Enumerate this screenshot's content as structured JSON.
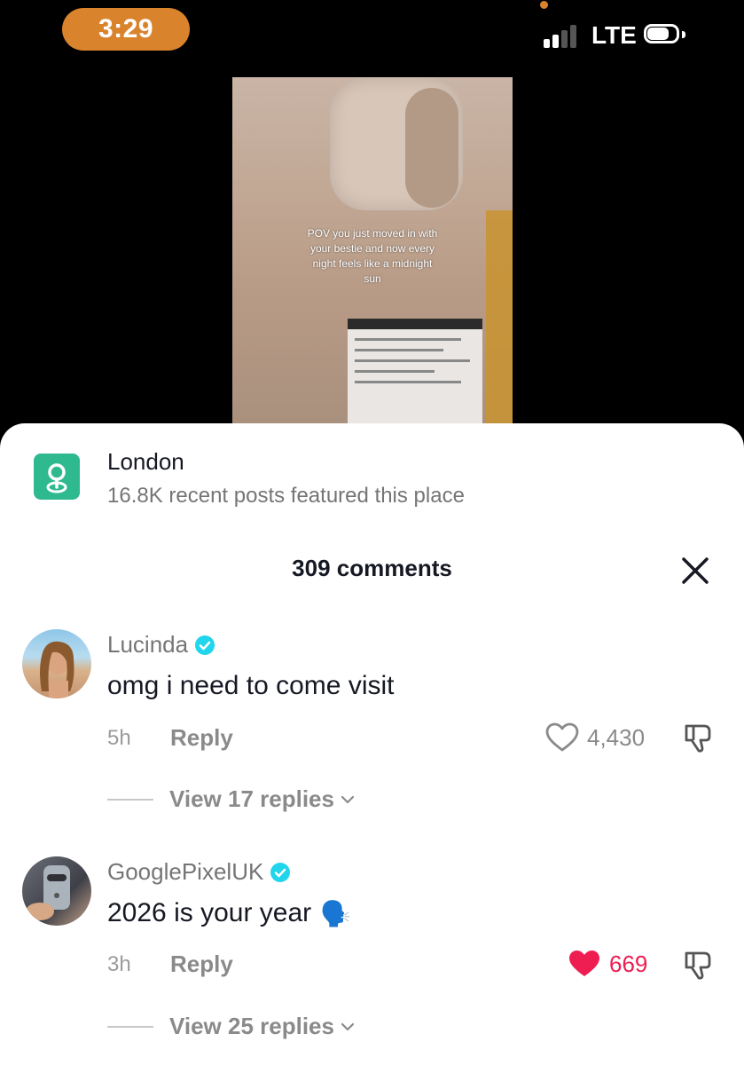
{
  "status_bar": {
    "time": "3:29",
    "network": "LTE"
  },
  "video": {
    "caption": "POV you just moved in with your bestie and now every night feels like a midnight sun"
  },
  "location": {
    "name": "London",
    "subtitle": "16.8K recent posts featured this place",
    "icon": "location-pin-icon"
  },
  "comments_header": {
    "title": "309 comments"
  },
  "comments": [
    {
      "username": "Lucinda",
      "verified": true,
      "text": "omg i need to come visit",
      "emoji": "",
      "time": "5h",
      "reply_label": "Reply",
      "likes": "4,430",
      "liked": false,
      "view_replies": "View 17 replies"
    },
    {
      "username": "GooglePixelUK",
      "verified": true,
      "text": "2026 is your year",
      "emoji": "🗣️",
      "time": "3h",
      "reply_label": "Reply",
      "likes": "669",
      "liked": true,
      "view_replies": "View 25 replies"
    }
  ],
  "colors": {
    "time_pill": "#d9832c",
    "verified": "#20d5ec",
    "liked_heart": "#ee1d52",
    "location_icon_bg": "#2fb98f"
  }
}
